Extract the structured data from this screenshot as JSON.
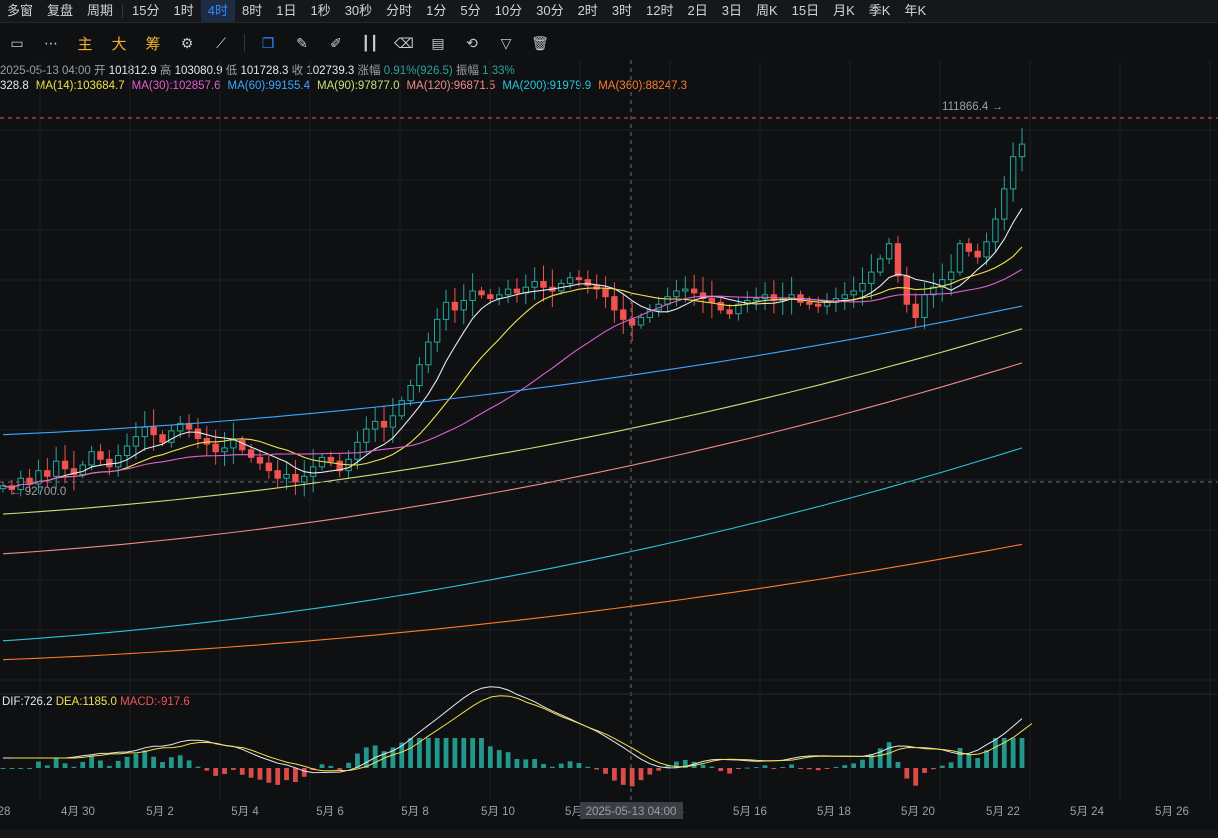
{
  "toolbar_top": {
    "items": [
      "多窗",
      "复盘",
      "周期",
      "15分",
      "1时",
      "4时",
      "8时",
      "1日",
      "1秒",
      "30秒",
      "分时",
      "1分",
      "5分",
      "10分",
      "30分",
      "2时",
      "3时",
      "12时",
      "2日",
      "3日",
      "周K",
      "15日",
      "月K",
      "季K",
      "年K"
    ],
    "selected": "4时"
  },
  "toolbar_draw": {
    "labels": [
      "主",
      "大",
      "筹"
    ],
    "icons": [
      "rectangle-icon",
      "more-dots-icon",
      "settings-icon",
      "crosshair-icon",
      "copy-icon",
      "ruler-icon",
      "pen-icon",
      "candles-icon",
      "delete-icon",
      "text-icon",
      "fibonacci-icon",
      "filter-icon",
      "trash-icon"
    ]
  },
  "ohlc": {
    "date": "2025-05-13 04:00",
    "open_label": "开",
    "open": "101812.9",
    "high_label": "高",
    "high": "103080.9",
    "low_label": "低",
    "low": "101728.3",
    "close_label": "收",
    "close": "102739.3",
    "change_label": "涨幅",
    "change": "0.91%(926.5)",
    "amp_label": "振幅",
    "amp": "1.33%"
  },
  "ma_legend": [
    {
      "text": "328.8",
      "color": "#e7e9ee"
    },
    {
      "text": "MA(14):103684.7",
      "color": "#f4e04d"
    },
    {
      "text": "MA(30):102857.6",
      "color": "#e15fd0"
    },
    {
      "text": "MA(60):99155.4",
      "color": "#3ea6ff"
    },
    {
      "text": "MA(90):97877.0",
      "color": "#c9e07a"
    },
    {
      "text": "MA(120):96871.5",
      "color": "#f08a8a"
    },
    {
      "text": "MA(200):91979.9",
      "color": "#26c6da"
    },
    {
      "text": "MA(360):88247.3",
      "color": "#ff7a2a"
    }
  ],
  "macd_legend": {
    "dif": "DIF:726.2",
    "dea": "DEA:1185.0",
    "macd": "MACD:-917.6"
  },
  "price_annotations": {
    "high": "111866.4",
    "low": "92700.0"
  },
  "crosshair_date": "2025-05-13 04:00",
  "colors": {
    "up": "#26a69a",
    "down": "#ef5350",
    "bg": "#0f1012",
    "grid": "#1c1e22",
    "accent": "#2f8bff"
  },
  "chart_data": {
    "type": "candlestick",
    "interval": "4h",
    "x_ticks": [
      "28",
      "4月 30",
      "5月 2",
      "5月 4",
      "5月 6",
      "5月 8",
      "5月 10",
      "5月 12",
      "5月 14",
      "5月 16",
      "5月 18",
      "5月 20",
      "5月 22",
      "5月 24",
      "5月 26"
    ],
    "close_path": [
      93800,
      93600,
      94200,
      93900,
      94600,
      94300,
      95100,
      94700,
      94400,
      94900,
      95600,
      95200,
      94800,
      95400,
      95900,
      96400,
      96900,
      96500,
      96100,
      96700,
      97100,
      96800,
      96300,
      96000,
      95600,
      95800,
      96200,
      95700,
      95300,
      95000,
      94600,
      94200,
      94400,
      94000,
      94300,
      94800,
      95300,
      95100,
      94600,
      95200,
      96100,
      96800,
      97200,
      96900,
      97500,
      98300,
      99100,
      100200,
      101400,
      102600,
      103500,
      103100,
      103600,
      104100,
      103900,
      103700,
      103900,
      104200,
      104000,
      104300,
      104600,
      104300,
      104100,
      104500,
      104800,
      104700,
      104400,
      104200,
      103800,
      103100,
      102600,
      102300,
      102700,
      103100,
      103400,
      103800,
      104100,
      104200,
      104000,
      103700,
      103500,
      103100,
      102900,
      103400,
      103600,
      103700,
      103900,
      103600,
      103700,
      103900,
      103500,
      103400,
      103300,
      103500,
      103700,
      103900,
      104100,
      104500,
      105100,
      105800,
      106600,
      104900,
      103400,
      102700,
      103900,
      104300,
      104700,
      105100,
      106600,
      106200,
      105900,
      106700,
      107900,
      109500,
      111200,
      111866
    ],
    "ma_series": [
      "MA(14)",
      "MA(30)",
      "MA(60)",
      "MA(90)",
      "MA(120)",
      "MA(200)",
      "MA(360)"
    ],
    "macd": {
      "dif": 726.2,
      "dea": 1185.0,
      "macd": -917.6
    }
  }
}
